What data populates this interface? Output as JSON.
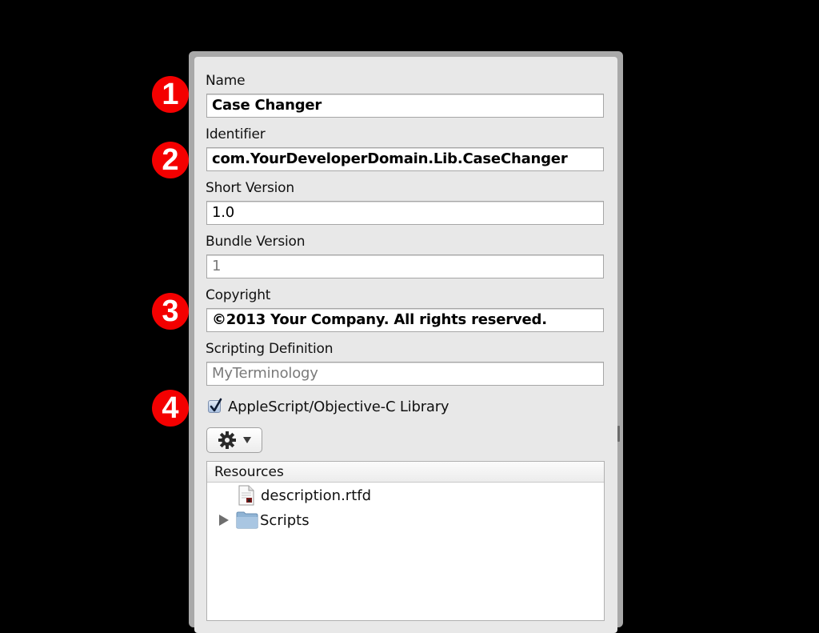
{
  "form": {
    "name": {
      "label": "Name",
      "value": "Case Changer"
    },
    "identifier": {
      "label": "Identifier",
      "value": "com.YourDeveloperDomain.Lib.CaseChanger"
    },
    "short_version": {
      "label": "Short Version",
      "value": "1.0"
    },
    "bundle_version": {
      "label": "Bundle Version",
      "value": "1"
    },
    "copyright": {
      "label": "Copyright",
      "value": "©2013 Your Company. All rights reserved."
    },
    "scripting_definition": {
      "label": "Scripting Definition",
      "placeholder": "MyTerminology"
    },
    "asoc_library": {
      "label": "AppleScript/Objective-C Library",
      "checked": true
    }
  },
  "callouts": [
    "1",
    "2",
    "3",
    "4"
  ],
  "toolbar": {
    "action_menu_icon": "gear-icon",
    "dropdown_icon": "triangle-down-icon"
  },
  "resources": {
    "header": "Resources",
    "items": [
      {
        "name": "description.rtfd",
        "icon": "rtfd-document-icon",
        "expandable": false
      },
      {
        "name": "Scripts",
        "icon": "folder-icon",
        "expandable": true
      }
    ]
  },
  "colors": {
    "callout_red": "#f40000",
    "panel_bg": "#e8e8e8"
  }
}
